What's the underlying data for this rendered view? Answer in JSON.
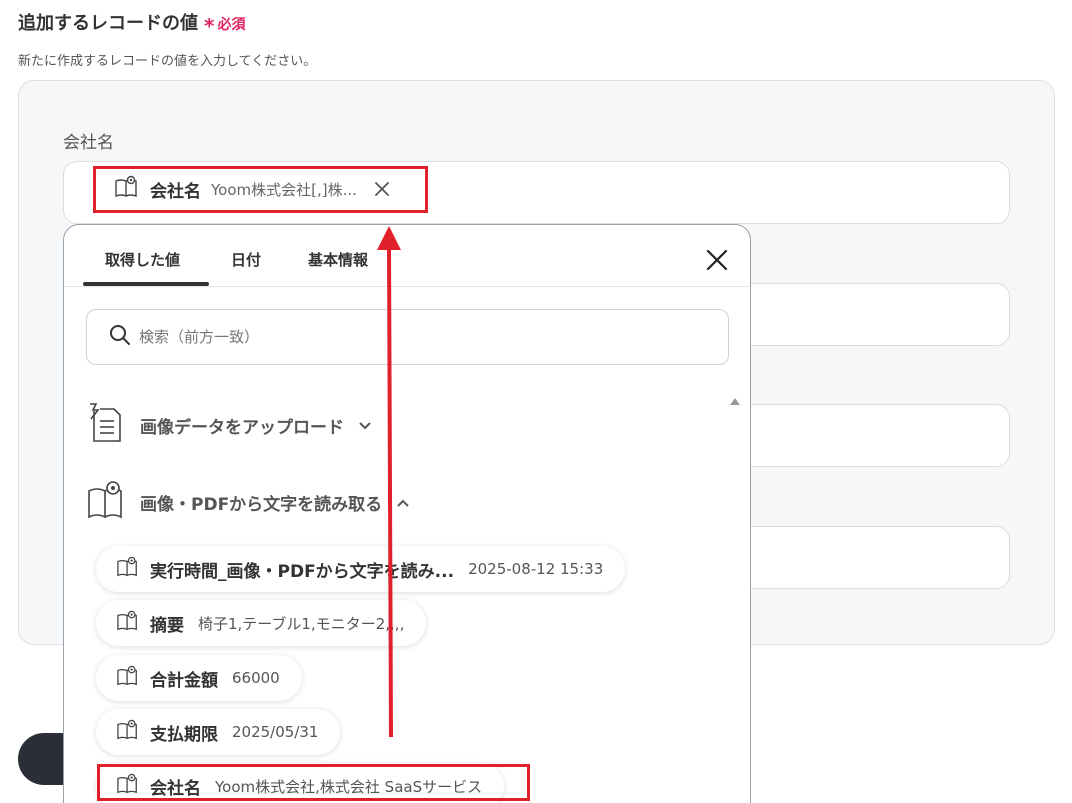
{
  "section": {
    "title": "追加するレコードの値",
    "required_mark": "*",
    "required_label": "必須",
    "description": "新たに作成するレコードの値を入力してください。"
  },
  "field": {
    "label": "会社名",
    "chip_label": "会社名",
    "chip_value": "Yoom株式会社[,]株..."
  },
  "popup": {
    "tabs": [
      {
        "label": "取得した値",
        "active": true
      },
      {
        "label": "日付",
        "active": false
      },
      {
        "label": "基本情報",
        "active": false
      }
    ],
    "search_placeholder": "検索（前方一致）",
    "groups": [
      {
        "label": "画像データをアップロード",
        "icon": "upload-document-icon",
        "expanded": false
      },
      {
        "label": "画像・PDFから文字を読み取る",
        "icon": "ocr-book-icon",
        "expanded": true
      }
    ],
    "items": [
      {
        "label": "実行時間_画像・PDFから文字を読み...",
        "value": "2025-08-12 15:33"
      },
      {
        "label": "摘要",
        "value": "椅子1,テーブル1,モニター2,,,,"
      },
      {
        "label": "合計金額",
        "value": "66000"
      },
      {
        "label": "支払期限",
        "value": "2025/05/31"
      },
      {
        "label": "会社名",
        "value": "Yoom株式会社,株式会社 SaaSサービス"
      }
    ]
  },
  "colors": {
    "accent_red": "#e0202a",
    "required_pink": "#e0245e",
    "panel_bg": "#f6f7f9"
  }
}
